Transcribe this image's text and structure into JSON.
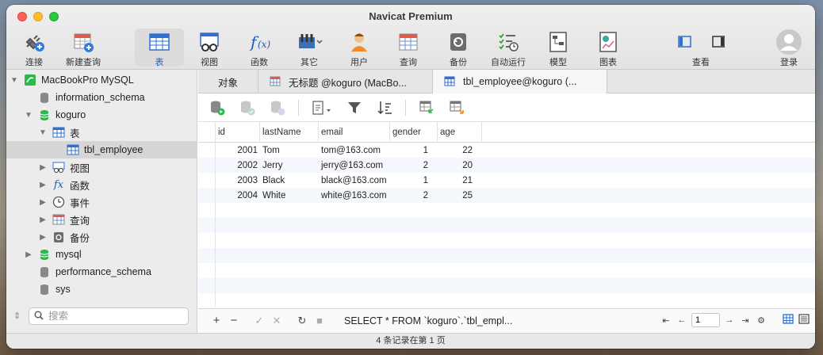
{
  "window": {
    "title": "Navicat Premium"
  },
  "toolbar": {
    "items": [
      {
        "label": "连接",
        "icon": "plug-icon"
      },
      {
        "label": "新建查询",
        "icon": "new-query-icon"
      },
      {
        "label": "表",
        "icon": "table-icon"
      },
      {
        "label": "视图",
        "icon": "view-icon"
      },
      {
        "label": "函数",
        "icon": "function-icon"
      },
      {
        "label": "其它",
        "icon": "tools-icon"
      },
      {
        "label": "用户",
        "icon": "user-icon"
      },
      {
        "label": "查询",
        "icon": "query-icon"
      },
      {
        "label": "备份",
        "icon": "backup-icon"
      },
      {
        "label": "自动运行",
        "icon": "automation-icon"
      },
      {
        "label": "模型",
        "icon": "model-icon"
      },
      {
        "label": "图表",
        "icon": "chart-icon"
      },
      {
        "label": "查看",
        "icon": "view-toggle-icon"
      },
      {
        "label": "登录",
        "icon": "login-avatar-icon"
      }
    ]
  },
  "sidebar": {
    "connection": "MacBookPro MySQL",
    "items": [
      {
        "label": "information_schema"
      },
      {
        "label": "koguro"
      },
      {
        "label": "表"
      },
      {
        "label": "tbl_employee"
      },
      {
        "label": "视图"
      },
      {
        "label": "函数"
      },
      {
        "label": "事件"
      },
      {
        "label": "查询"
      },
      {
        "label": "备份"
      },
      {
        "label": "mysql"
      },
      {
        "label": "performance_schema"
      },
      {
        "label": "sys"
      }
    ],
    "search_placeholder": "搜索"
  },
  "tabs": [
    {
      "label": "对象"
    },
    {
      "label": "无标题 @koguro (MacBo..."
    },
    {
      "label": "tbl_employee@koguro (..."
    }
  ],
  "grid": {
    "columns": [
      "id",
      "lastName",
      "email",
      "gender",
      "age"
    ],
    "rows": [
      [
        "2001",
        "Tom",
        "tom@163.com",
        "1",
        "22"
      ],
      [
        "2002",
        "Jerry",
        "jerry@163.com",
        "2",
        "20"
      ],
      [
        "2003",
        "Black",
        "black@163.com",
        "1",
        "21"
      ],
      [
        "2004",
        "White",
        "white@163.com",
        "2",
        "25"
      ]
    ]
  },
  "bottombar": {
    "sql": "SELECT * FROM `koguro`.`tbl_empl...",
    "page": "1"
  },
  "status": {
    "text": "4 条记录在第 1 页"
  },
  "colors": {
    "accent": "#1f63c6",
    "db_green": "#2eb84a"
  }
}
